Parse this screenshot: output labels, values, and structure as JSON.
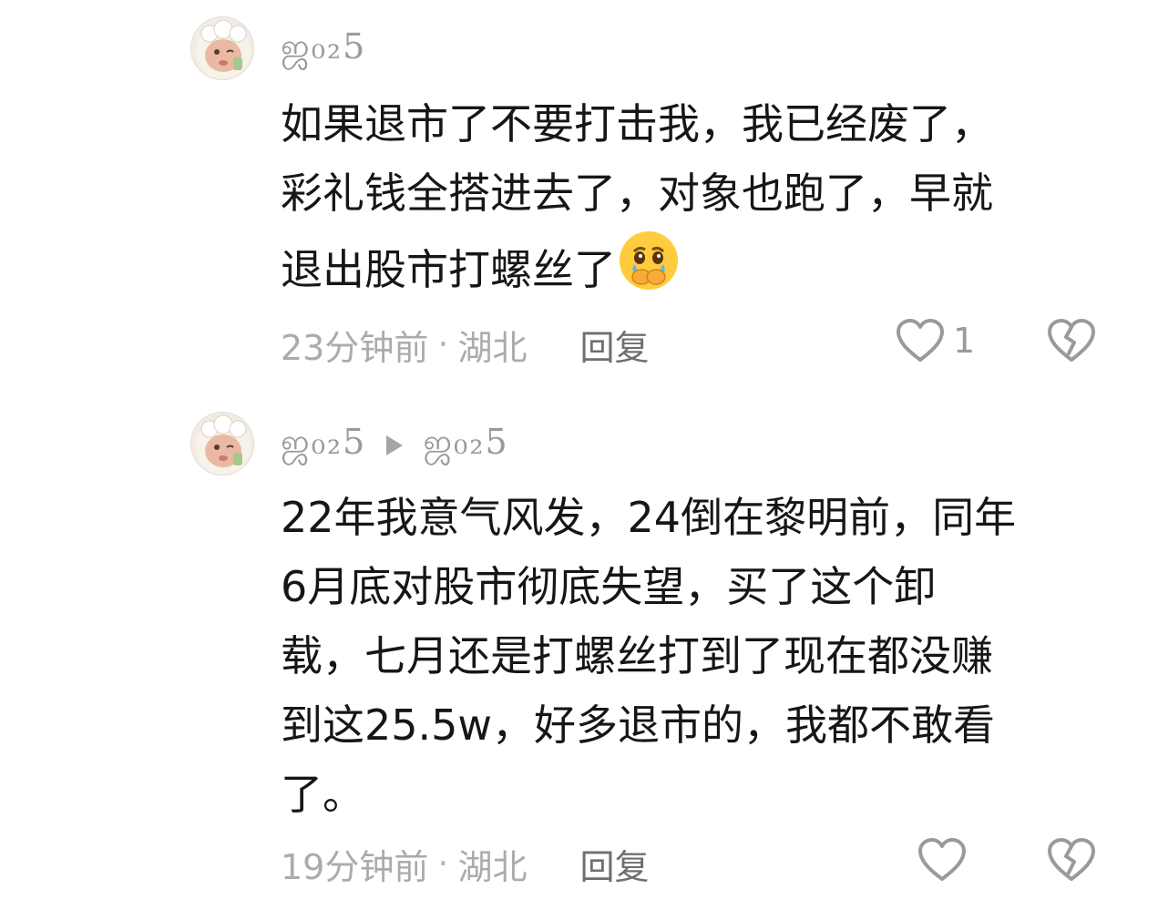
{
  "comments": [
    {
      "username": "ஜ₀₂5",
      "text_line1": "如果退市了不要打击我，我已经废了，",
      "text_line2": "彩礼钱全搭进去了，对象也跑了，早就",
      "text_line3": "退出股市打螺丝了",
      "emoji": "crying-covering-mouth-emoji",
      "time": "23分钟前",
      "dot": "·",
      "location": "湖北",
      "reply_label": "回复",
      "like_count": "1"
    },
    {
      "username": "ஜ₀₂5",
      "reply_to": "ஜ₀₂5",
      "text_line1": "22年我意气风发，24倒在黎明前，同年",
      "text_line2": "6月底对股市彻底失望，买了这个卸",
      "text_line3": "载，七月还是打螺丝打到了现在都没赚",
      "text_line4": "到这25.5w，好多退市的，我都不敢看",
      "text_line5": "了。",
      "time": "19分钟前",
      "dot": "·",
      "location": "湖北",
      "reply_label": "回复",
      "like_count": ""
    }
  ],
  "colors": {
    "text": "#161616",
    "muted": "#ababab",
    "reply": "#6f6f6f",
    "icon": "#9a9a9a"
  }
}
